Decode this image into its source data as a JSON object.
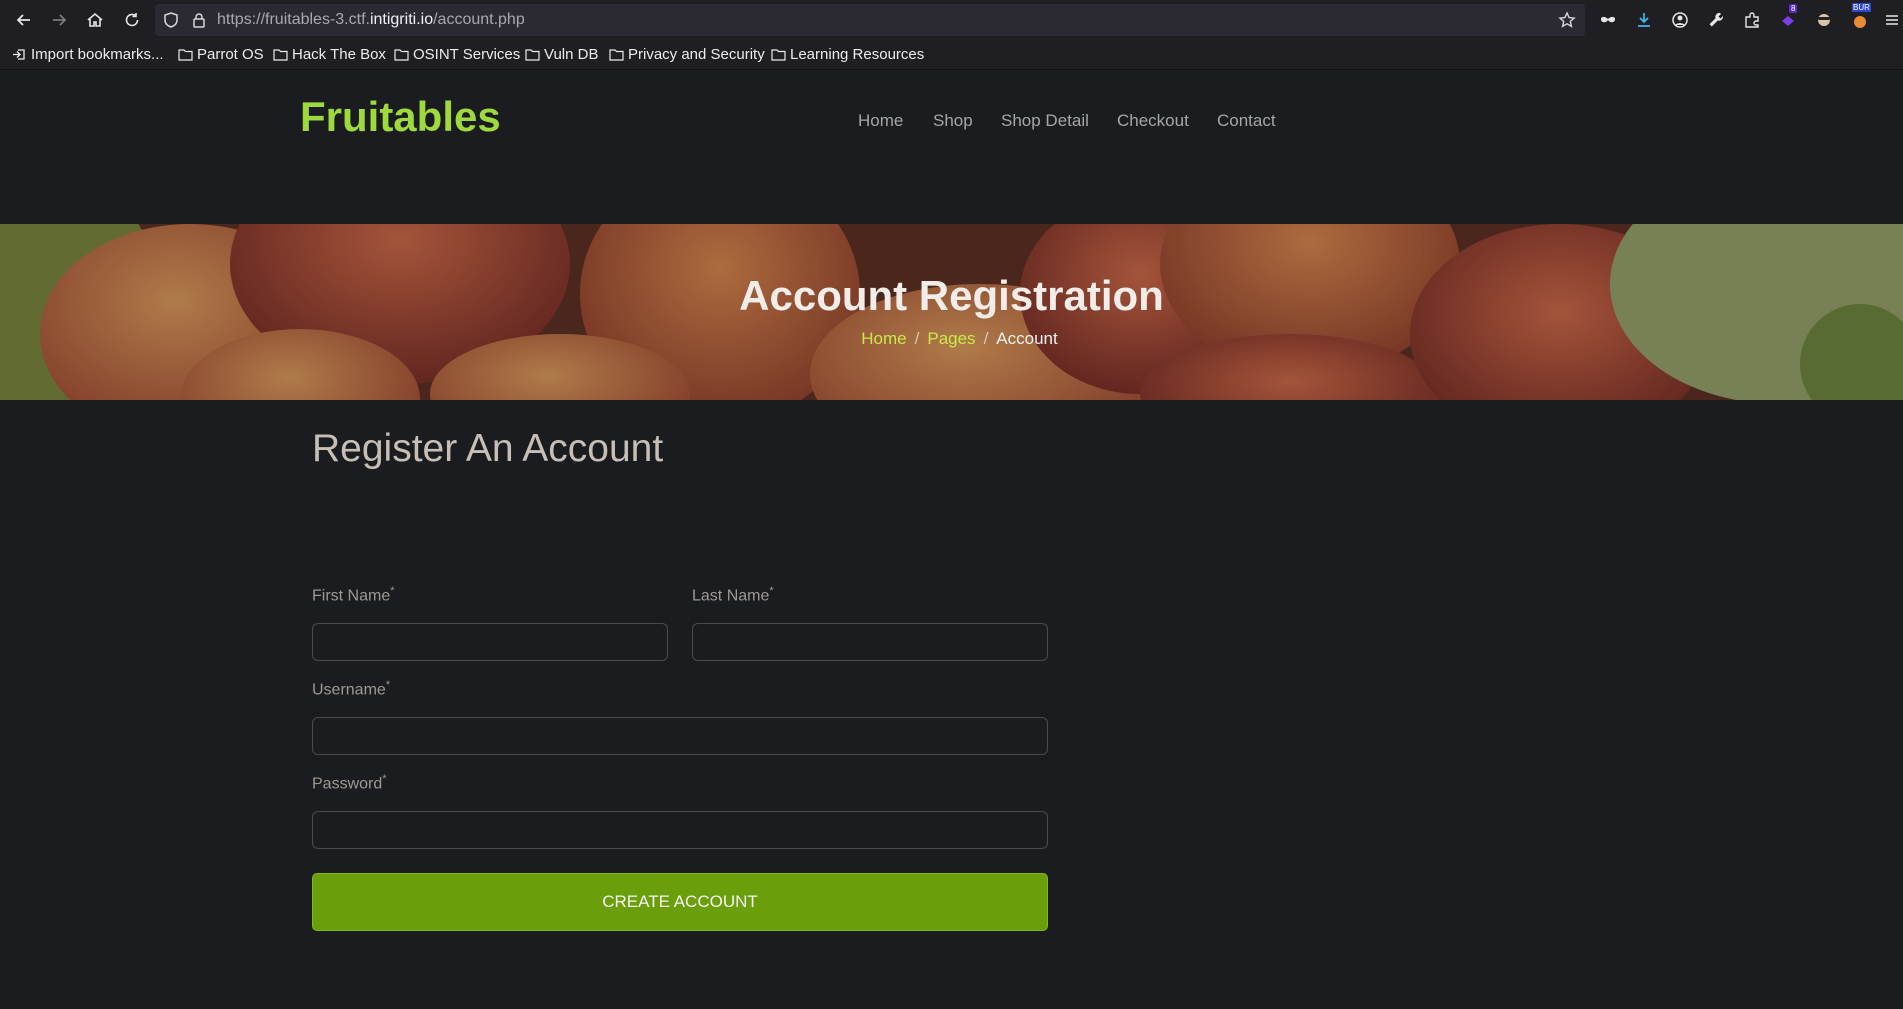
{
  "browser": {
    "url_prefix": "https://fruitables-3.ctf.",
    "url_domain": "intigriti.io",
    "url_path": "/account.php",
    "extension_badge": "8",
    "burp_badge": "BUR",
    "bookmarks": [
      {
        "label": "Import bookmarks...",
        "icon": "import-icon"
      },
      {
        "label": "Parrot OS",
        "icon": "folder-icon"
      },
      {
        "label": "Hack The Box",
        "icon": "folder-icon"
      },
      {
        "label": "OSINT Services",
        "icon": "folder-icon"
      },
      {
        "label": "Vuln DB",
        "icon": "folder-icon"
      },
      {
        "label": "Privacy and Security",
        "icon": "folder-icon"
      },
      {
        "label": "Learning Resources",
        "icon": "folder-icon"
      }
    ]
  },
  "site": {
    "brand": "Fruitables",
    "nav": [
      "Home",
      "Shop",
      "Shop Detail",
      "Checkout",
      "Contact"
    ]
  },
  "hero": {
    "title": "Account Registration",
    "breadcrumb": [
      "Home",
      "Pages",
      "Account"
    ],
    "separator": "/"
  },
  "form": {
    "heading": "Register An Account",
    "first_name_label": "First Name",
    "last_name_label": "Last Name",
    "username_label": "Username",
    "password_label": "Password",
    "required_mark": "*",
    "first_name_value": "",
    "last_name_value": "",
    "username_value": "",
    "password_value": "",
    "submit_label": "Create Account"
  },
  "colors": {
    "brand": "#9ed93e",
    "accent_button": "#6a9f0b",
    "breadcrumb_link": "#c9e94a",
    "page_bg": "#1b1c1f"
  }
}
